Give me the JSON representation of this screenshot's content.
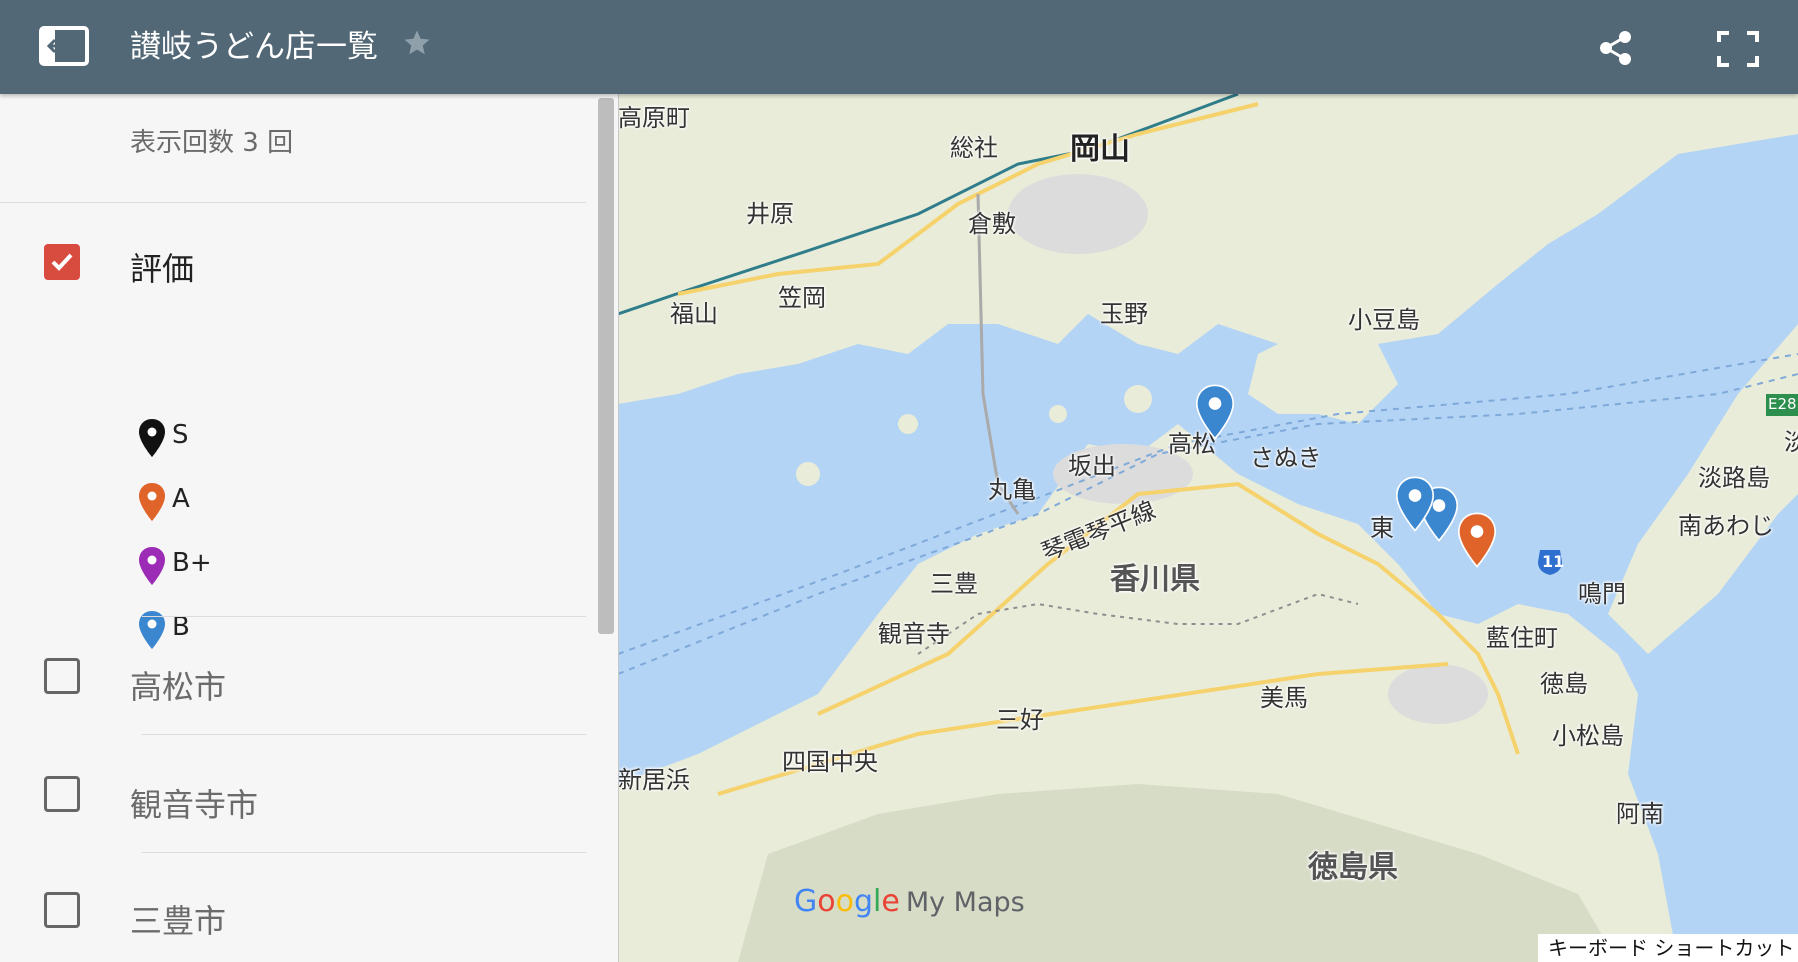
{
  "header": {
    "title": "讃岐うどん店一覧",
    "star_icon": "star-icon",
    "share_icon": "share-icon",
    "fullscreen_icon": "fullscreen-icon",
    "panel_toggle_icon": "panel-toggle-icon"
  },
  "panel": {
    "views_text": "表示回数 3 回",
    "layers": [
      {
        "label": "評価",
        "checked": true
      },
      {
        "label": "高松市",
        "checked": false
      },
      {
        "label": "観音寺市",
        "checked": false
      },
      {
        "label": "三豊市",
        "checked": false
      }
    ],
    "legend": [
      {
        "label": "S",
        "color": "#111111"
      },
      {
        "label": "A",
        "color": "#e0642a"
      },
      {
        "label": "B+",
        "color": "#9c2bb5"
      },
      {
        "label": "B",
        "color": "#3a86cf"
      }
    ]
  },
  "map": {
    "labels": {
      "takahara": "高原町",
      "soja": "総社",
      "okayama": "岡山",
      "ibara": "井原",
      "kurashiki": "倉敷",
      "kasaoka": "笠岡",
      "fukuyama": "福山",
      "tamano": "玉野",
      "shodoshima": "小豆島",
      "takamatsu": "高松",
      "sakaide": "坂出",
      "sanuki": "さぬき",
      "marugame": "丸亀",
      "kotoden": "琴電琴平線",
      "kagawa": "香川県",
      "higashikagawa": "東",
      "awaji": "淡路島",
      "minamiawaji": "南あわじ",
      "naruto": "鳴門",
      "mitoyo": "三豊",
      "kanonji": "観音寺",
      "aizumi": "藍住町",
      "tokushima": "徳島",
      "mima": "美馬",
      "miyoshi": "三好",
      "komatsushima": "小松島",
      "shikokuchuo": "四国中央",
      "niihama": "新居浜",
      "anan": "阿南",
      "tokushima_pref": "徳島県",
      "route_11": "11",
      "e28": "E28",
      "awa": "淡"
    },
    "markers": [
      {
        "rating": "B",
        "color": "#3a86cf"
      },
      {
        "rating": "B",
        "color": "#3a86cf"
      },
      {
        "rating": "B",
        "color": "#3a86cf"
      },
      {
        "rating": "A",
        "color": "#e0642a"
      }
    ],
    "branding": {
      "google": [
        "G",
        "o",
        "o",
        "g",
        "l",
        "e"
      ],
      "my_maps": "My Maps"
    },
    "keyboard_shortcuts": "キーボード ショートカット"
  },
  "colors": {
    "header": "#526876",
    "panel": "#f6f6f6",
    "checkbox_checked": "#d84b3f",
    "water": "#b4d4f5",
    "land": "#e8ecd9"
  }
}
